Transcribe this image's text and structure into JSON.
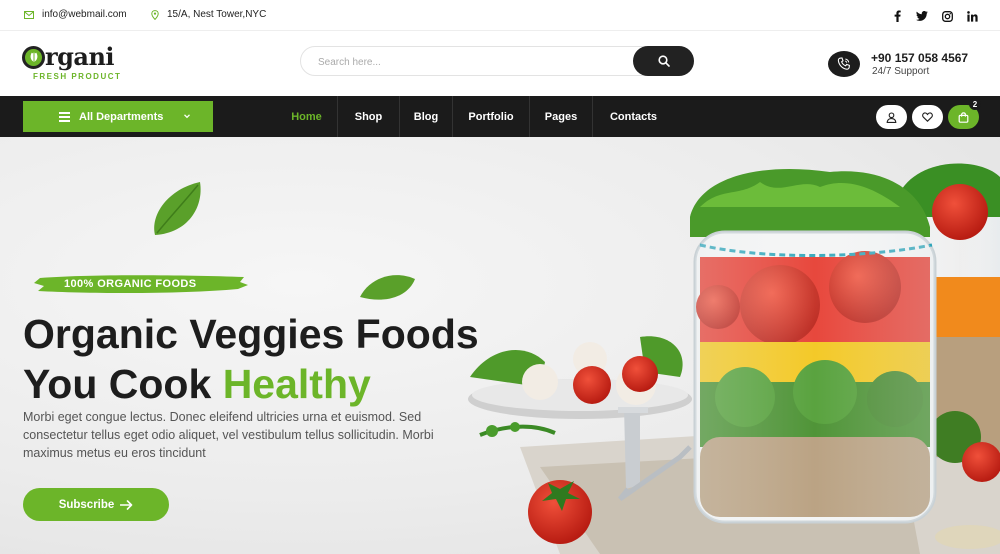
{
  "topbar": {
    "email": "info@webmail.com",
    "address": "15/A, Nest Tower,NYC",
    "socials": [
      "facebook-icon",
      "twitter-icon",
      "instagram-icon",
      "linkedin-icon"
    ]
  },
  "header": {
    "logo_text": "rgani",
    "logo_subtitle": "FRESH PRODUCT",
    "search_placeholder": "Search here...",
    "phone": "+90 157 058 4567",
    "support_label": "24/7 Support"
  },
  "nav": {
    "departments_label": "All Departments",
    "items": [
      "Home",
      "Shop",
      "Blog",
      "Portfolio",
      "Pages",
      "Contacts"
    ],
    "active_item": "Home",
    "cart_count": "2"
  },
  "hero": {
    "badge": "100% ORGANIC FOODS",
    "title_line1": "Organic Veggies Foods",
    "title_line2_dark": "You Cook ",
    "title_line2_green": "Healthy",
    "description": "Morbi eget congue lectus. Donec eleifend ultricies urna et euismod. Sed consectetur tellus eget odio aliquet, vel vestibulum tellus sollicitudin. Morbi maximus metus eu eros tincidunt",
    "cta_label": "Subscribe"
  },
  "colors": {
    "brand_green": "#6cb529",
    "dark": "#1b1b1b",
    "tomato_red": "#d92b1e"
  }
}
